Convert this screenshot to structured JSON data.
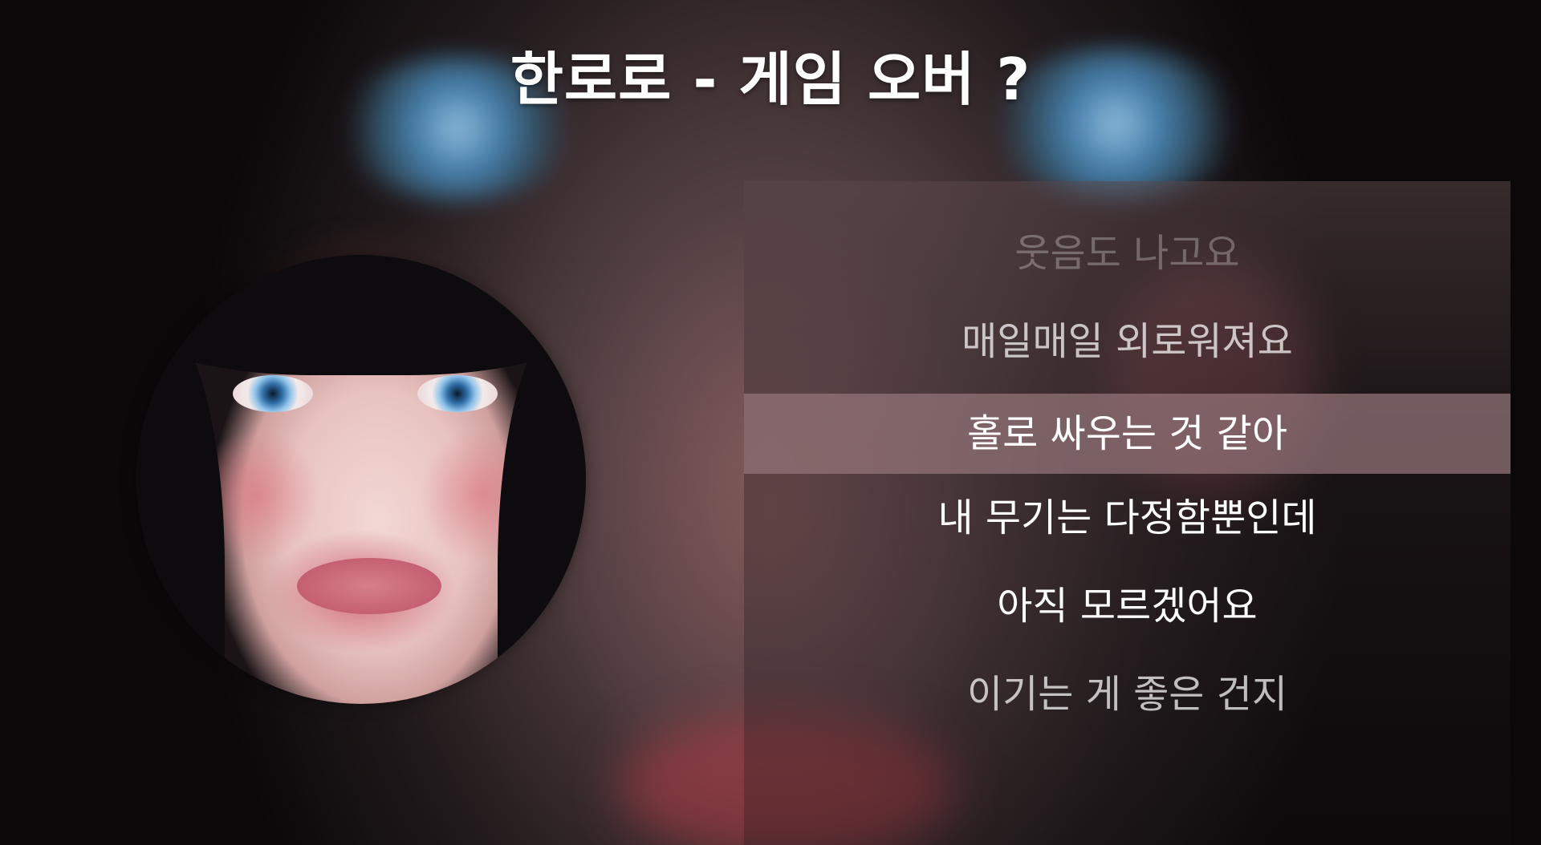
{
  "song": {
    "title": "한로로 - 게임 오버 ?"
  },
  "lyrics": [
    {
      "text": "웃음도 나고요",
      "state": "past-faded"
    },
    {
      "text": "매일매일 외로워져요",
      "state": "past"
    },
    {
      "text": "홀로 싸우는 것 같아",
      "state": "current"
    },
    {
      "text": "내 무기는 다정함뿐인데",
      "state": "upcoming"
    },
    {
      "text": "아직 모르겠어요",
      "state": "upcoming"
    },
    {
      "text": "이기는 게 좋은 건지",
      "state": "upcoming-faded"
    }
  ],
  "colors": {
    "highlight": "#96767a",
    "text": "#ffffff"
  }
}
